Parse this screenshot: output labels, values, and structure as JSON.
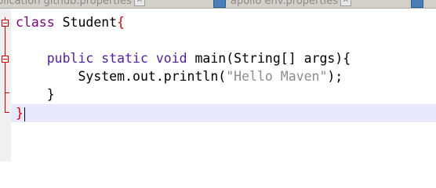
{
  "tabs": [
    {
      "label": "plication github.properties",
      "close": "✕"
    },
    {
      "label": "apollo env.properties",
      "close": "✕"
    },
    {
      "label": "",
      "close": "✕"
    }
  ],
  "code": {
    "line1": {
      "kw": "class",
      "rest": " Student",
      "brace": "{"
    },
    "line3": {
      "indent": "    ",
      "kw": "public static void",
      "rest": " main(String[] args){"
    },
    "line4": {
      "indent": "        ",
      "pre": "System.out.println(",
      "str": "\"Hello Maven\"",
      "post": ");"
    },
    "line5": {
      "indent": "    ",
      "text": "}"
    },
    "line6": {
      "brace": "}"
    }
  }
}
